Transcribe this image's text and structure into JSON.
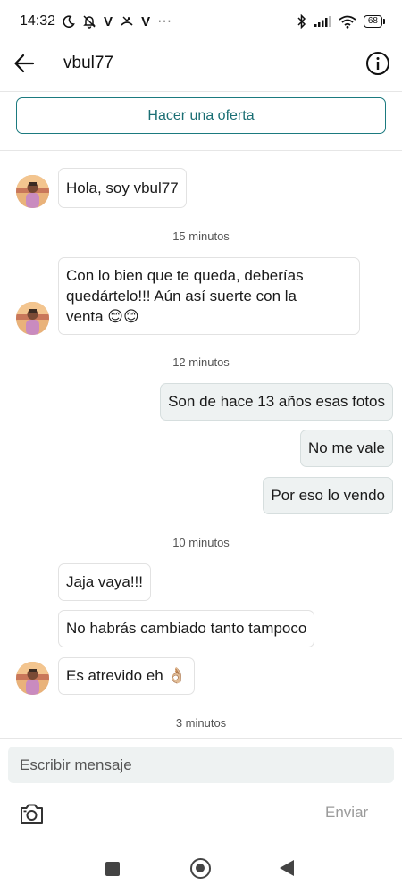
{
  "status_bar": {
    "time": "14:32",
    "left_glyphs": [
      "V",
      "V"
    ],
    "dots": "···",
    "battery": "68"
  },
  "header": {
    "title": "vbul77"
  },
  "offer_button": "Hacer una oferta",
  "messages": [
    {
      "type": "in",
      "text": "Hola, soy vbul77"
    },
    {
      "type": "time",
      "text": "15 minutos"
    },
    {
      "type": "in",
      "lines": [
        "Con lo bien que te queda, deberías",
        "quedártelo!!! Aún así suerte con la",
        "venta 😊😊"
      ]
    },
    {
      "type": "time",
      "text": "12 minutos"
    },
    {
      "type": "out",
      "text": "Son de hace 13 años esas fotos"
    },
    {
      "type": "out",
      "text": "No me vale"
    },
    {
      "type": "out",
      "text": "Por eso lo vendo"
    },
    {
      "type": "time",
      "text": "10 minutos"
    },
    {
      "type": "in",
      "text": "Jaja vaya!!!"
    },
    {
      "type": "in",
      "text": "No habrás cambiado tanto tampoco"
    },
    {
      "type": "in",
      "text": "Es atrevido eh 👌🏼"
    },
    {
      "type": "time",
      "text": "3 minutos"
    }
  ],
  "composer": {
    "placeholder": "Escribir mensaje",
    "send_label": "Enviar"
  },
  "colors": {
    "accent": "#1b7a7f",
    "outgoing_bubble": "#eef2f2",
    "input_bg": "#eef2f2"
  }
}
